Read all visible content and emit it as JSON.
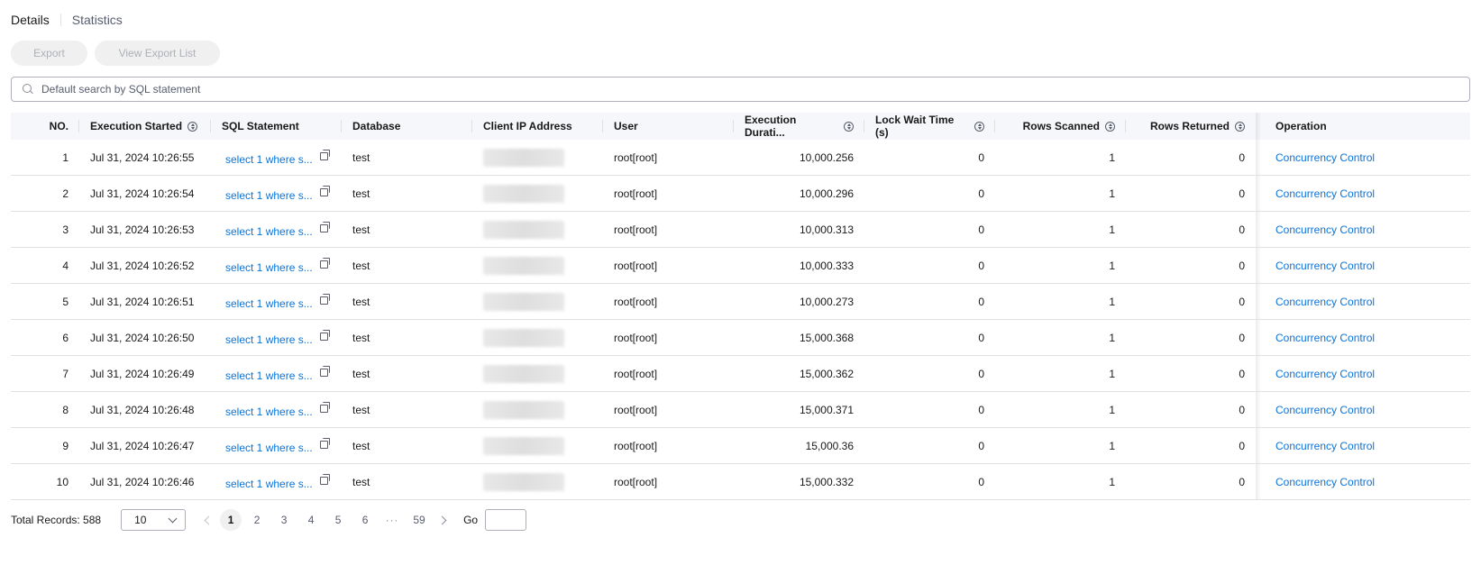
{
  "tabs": [
    {
      "label": "Details",
      "active": true
    },
    {
      "label": "Statistics",
      "active": false
    }
  ],
  "toolbar": {
    "export_label": "Export",
    "view_export_list_label": "View Export List"
  },
  "search": {
    "placeholder": "Default search by SQL statement",
    "value": ""
  },
  "table": {
    "columns": {
      "no": "NO.",
      "start": "Execution Started",
      "sql": "SQL Statement",
      "db": "Database",
      "ip": "Client IP Address",
      "user": "User",
      "duration": "Execution Durati...",
      "lock": "Lock Wait Time (s)",
      "scanned": "Rows Scanned",
      "returned": "Rows Returned",
      "operation": "Operation"
    },
    "rows": [
      {
        "no": "1",
        "start": "Jul 31, 2024 10:26:55",
        "sql": "select 1 where s...",
        "db": "test",
        "user": "root[root]",
        "duration": "10,000.256",
        "lock": "0",
        "scanned": "1",
        "returned": "0",
        "op": "Concurrency Control"
      },
      {
        "no": "2",
        "start": "Jul 31, 2024 10:26:54",
        "sql": "select 1 where s...",
        "db": "test",
        "user": "root[root]",
        "duration": "10,000.296",
        "lock": "0",
        "scanned": "1",
        "returned": "0",
        "op": "Concurrency Control"
      },
      {
        "no": "3",
        "start": "Jul 31, 2024 10:26:53",
        "sql": "select 1 where s...",
        "db": "test",
        "user": "root[root]",
        "duration": "10,000.313",
        "lock": "0",
        "scanned": "1",
        "returned": "0",
        "op": "Concurrency Control"
      },
      {
        "no": "4",
        "start": "Jul 31, 2024 10:26:52",
        "sql": "select 1 where s...",
        "db": "test",
        "user": "root[root]",
        "duration": "10,000.333",
        "lock": "0",
        "scanned": "1",
        "returned": "0",
        "op": "Concurrency Control"
      },
      {
        "no": "5",
        "start": "Jul 31, 2024 10:26:51",
        "sql": "select 1 where s...",
        "db": "test",
        "user": "root[root]",
        "duration": "10,000.273",
        "lock": "0",
        "scanned": "1",
        "returned": "0",
        "op": "Concurrency Control"
      },
      {
        "no": "6",
        "start": "Jul 31, 2024 10:26:50",
        "sql": "select 1 where s...",
        "db": "test",
        "user": "root[root]",
        "duration": "15,000.368",
        "lock": "0",
        "scanned": "1",
        "returned": "0",
        "op": "Concurrency Control"
      },
      {
        "no": "7",
        "start": "Jul 31, 2024 10:26:49",
        "sql": "select 1 where s...",
        "db": "test",
        "user": "root[root]",
        "duration": "15,000.362",
        "lock": "0",
        "scanned": "1",
        "returned": "0",
        "op": "Concurrency Control"
      },
      {
        "no": "8",
        "start": "Jul 31, 2024 10:26:48",
        "sql": "select 1 where s...",
        "db": "test",
        "user": "root[root]",
        "duration": "15,000.371",
        "lock": "0",
        "scanned": "1",
        "returned": "0",
        "op": "Concurrency Control"
      },
      {
        "no": "9",
        "start": "Jul 31, 2024 10:26:47",
        "sql": "select 1 where s...",
        "db": "test",
        "user": "root[root]",
        "duration": "15,000.36",
        "lock": "0",
        "scanned": "1",
        "returned": "0",
        "op": "Concurrency Control"
      },
      {
        "no": "10",
        "start": "Jul 31, 2024 10:26:46",
        "sql": "select 1 where s...",
        "db": "test",
        "user": "root[root]",
        "duration": "15,000.332",
        "lock": "0",
        "scanned": "1",
        "returned": "0",
        "op": "Concurrency Control"
      }
    ]
  },
  "pagination": {
    "total_label": "Total Records: 588",
    "page_size": "10",
    "pages": [
      "1",
      "2",
      "3",
      "4",
      "5",
      "6",
      "···",
      "59"
    ],
    "current_page": "1",
    "go_label": "Go",
    "go_value": ""
  },
  "colors": {
    "link": "#0b73d9",
    "header_bg": "#f6f7fa",
    "border": "#dfe1e6"
  },
  "icons": [
    "search-icon",
    "sort-icon",
    "copy-icon",
    "chevron-down-icon",
    "chevron-left-icon",
    "chevron-right-icon"
  ]
}
